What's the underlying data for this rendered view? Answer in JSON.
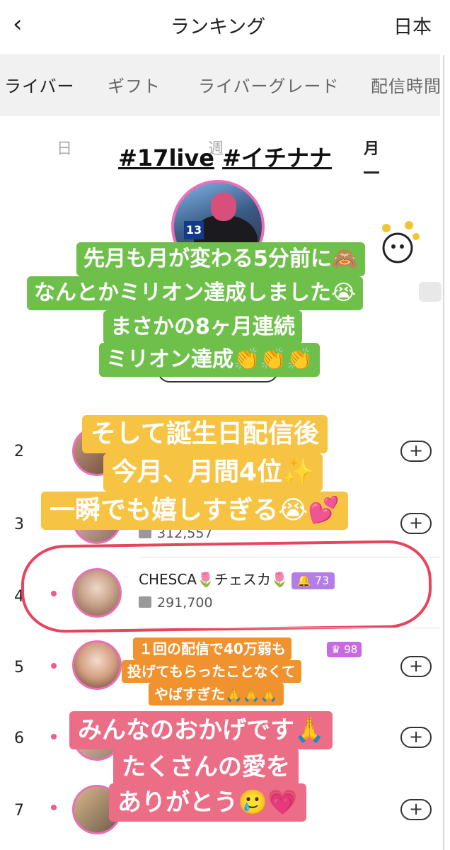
{
  "header": {
    "back_icon": "chevron-left-icon",
    "title": "ランキング",
    "region": "日本"
  },
  "tabs": [
    {
      "label": "ライバー",
      "active": true
    },
    {
      "label": "ギフト",
      "active": false
    },
    {
      "label": "ライバーグレード",
      "active": false
    },
    {
      "label": "配信時間",
      "active": false
    }
  ],
  "periods": [
    {
      "label": "日",
      "active": false
    },
    {
      "label": "週",
      "active": false
    },
    {
      "label": "月",
      "active": true
    }
  ],
  "overlay": {
    "hashtag_a": "#17live",
    "hashtag_b": "#イチナナ",
    "green_lines": [
      "先月も月が変わる5分前に🙈",
      "なんとかミリオン達成しました😭",
      "まさかの8ヶ月連続",
      "ミリオン達成👏👏👏"
    ],
    "yellow_lines": [
      "そして誕生日配信後",
      "今月、月間4位✨",
      "一瞬でも嬉しすぎる😭💕"
    ],
    "orange_lines": [
      "１回の配信で40万弱も",
      "投げてもらったことなくて",
      "やばすぎた🙏🙏🙏"
    ],
    "pink_lines": [
      "みんなのおかげです🙏",
      "たくさんの愛を",
      "ありがとう🥲💗"
    ]
  },
  "ranking": {
    "rows": [
      {
        "rank": "2"
      },
      {
        "rank": "3",
        "gift_partial": "312,557"
      },
      {
        "rank": "4",
        "name": "CHESCA🌷チェスカ🌷",
        "level": "73",
        "gift": "291,700"
      },
      {
        "rank": "5",
        "level": "98"
      },
      {
        "rank": "6"
      },
      {
        "rank": "7"
      }
    ],
    "follow_label": "+"
  },
  "colors": {
    "accent_pink": "#e86fb8",
    "highlight_ring": "#e8445c",
    "level_badge": "#b57ee6"
  }
}
